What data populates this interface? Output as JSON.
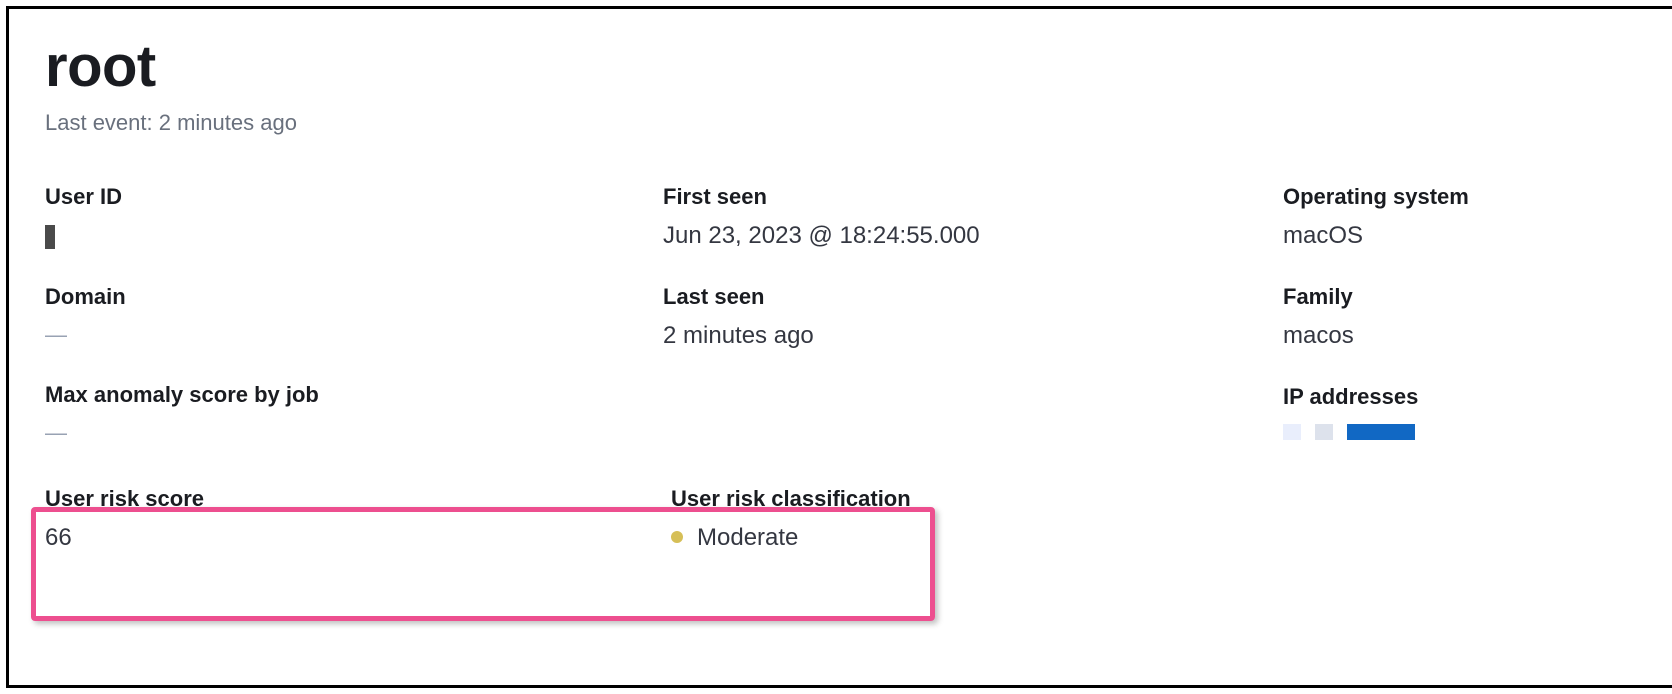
{
  "header": {
    "title": "root",
    "subtitle": "Last event: 2 minutes ago"
  },
  "fields": {
    "user_id_label": "User ID",
    "user_id_value": "",
    "domain_label": "Domain",
    "domain_value": "—",
    "max_anomaly_label": "Max anomaly score by job",
    "max_anomaly_value": "—",
    "first_seen_label": "First seen",
    "first_seen_value": "Jun 23, 2023 @ 18:24:55.000",
    "last_seen_label": "Last seen",
    "last_seen_value": "2 minutes ago",
    "os_label": "Operating system",
    "os_value": "macOS",
    "family_label": "Family",
    "family_value": "macos",
    "ip_label": "IP addresses"
  },
  "risk": {
    "score_label": "User risk score",
    "score_value": "66",
    "class_label": "User risk classification",
    "class_value": "Moderate"
  }
}
